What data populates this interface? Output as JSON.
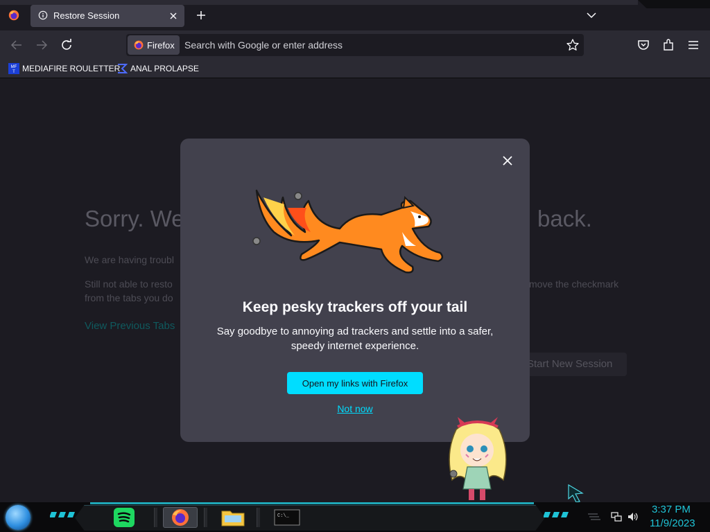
{
  "browser": {
    "tab": {
      "title": "Restore Session"
    },
    "identity_label": "Firefox",
    "url_placeholder": "Search with Google or enter address",
    "bookmarks": [
      {
        "label": "MEDIAFIRE ROULETTER",
        "icon": "mft-icon"
      },
      {
        "label": "ANAL PROLAPSE",
        "icon": "sigma-icon"
      }
    ]
  },
  "page": {
    "heading_left": "Sorry. We’",
    "heading_right": "back.",
    "para1": "We are having troubl",
    "para2_left": "Still not able to resto",
    "para2_right": "move the checkmark",
    "para3": "from the tabs you do",
    "view_previous": "View Previous Tabs",
    "start_new_session": "Start New Session"
  },
  "modal": {
    "title": "Keep pesky trackers off your tail",
    "subtitle": "Say goodbye to annoying ad trackers and settle into a safer, speedy internet experience.",
    "primary_button": "Open my links with Firefox",
    "secondary_link": "Not now"
  },
  "taskbar": {
    "time": "3:37 PM",
    "date": "11/9/2023",
    "apps": [
      "spotify",
      "firefox",
      "file-explorer",
      "command-prompt"
    ]
  },
  "colors": {
    "accent": "#00ddff",
    "page_bg": "#1c1b22",
    "toolbar_bg": "#2b2a33",
    "modal_bg": "#42414d",
    "taskbar_clock": "#1fc3d6"
  }
}
